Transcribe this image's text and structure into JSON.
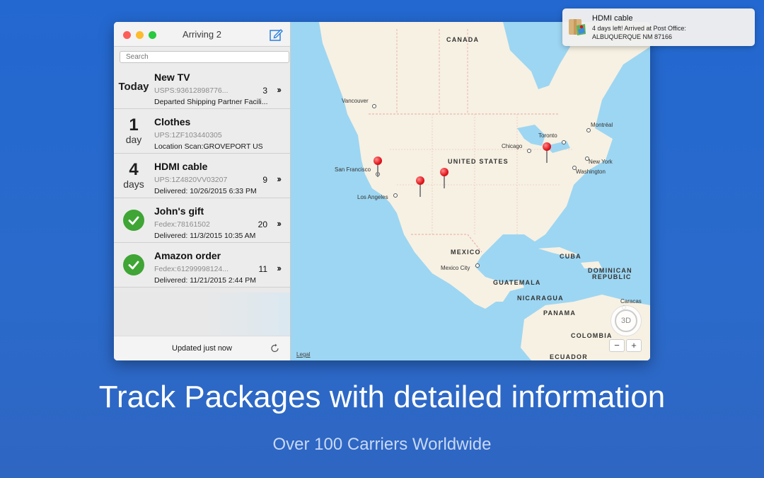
{
  "window": {
    "title": "Arriving 2",
    "search_placeholder": "Search",
    "footer_status": "Updated just now"
  },
  "packages": [
    {
      "name": "New TV",
      "eta_big": "",
      "eta_unit": "",
      "eta_label": "Today",
      "delivered": false,
      "tracking": "USPS:93612898776...",
      "status": "Departed Shipping Partner Facili...",
      "count": "3"
    },
    {
      "name": "Clothes",
      "eta_big": "1",
      "eta_unit": "day",
      "eta_label": "",
      "delivered": false,
      "tracking": "UPS:1ZF103440305",
      "status": "Location Scan:GROVEPORT US",
      "count": ""
    },
    {
      "name": "HDMI cable",
      "eta_big": "4",
      "eta_unit": "days",
      "eta_label": "",
      "delivered": false,
      "tracking": "UPS:1Z4820VV03207",
      "status": "Delivered: 10/26/2015 6:33 PM",
      "count": "9"
    },
    {
      "name": "John's gift",
      "eta_big": "",
      "eta_unit": "",
      "eta_label": "",
      "delivered": true,
      "tracking": "Fedex:78161502",
      "status": "Delivered: 11/3/2015 10:35 AM",
      "count": "20"
    },
    {
      "name": "Amazon order",
      "eta_big": "",
      "eta_unit": "",
      "eta_label": "",
      "delivered": true,
      "tracking": "Fedex:61299998124...",
      "status": "Delivered: 11/21/2015 2:44 PM",
      "count": "11"
    }
  ],
  "map": {
    "countries": [
      "CANADA",
      "UNITED STATES",
      "MEXICO",
      "CUBA",
      "DOMINICAN",
      "REPUBLIC",
      "GUATEMALA",
      "NICARAGUA",
      "PANAMA",
      "COLOMBIA",
      "ECUADOR"
    ],
    "cities": [
      "Vancouver",
      "San Francisco",
      "Los Angeles",
      "Chicago",
      "Toronto",
      "Montréal",
      "New York",
      "Washington",
      "Mexico City",
      "Caracas"
    ],
    "legal": "Legal",
    "compass_label": "3D",
    "zoom_out": "−",
    "zoom_in": "+"
  },
  "notification": {
    "title": "HDMI cable",
    "line1": "4 days left! Arrived at Post Office:",
    "line2": "ALBUQUERQUE NM 87166"
  },
  "marketing": {
    "headline": "Track Packages with detailed information",
    "subhead": "Over 100 Carriers Worldwide"
  },
  "colors": {
    "background": "#2368d0",
    "delivered_check": "#3fa535",
    "pin": "#e0141b",
    "water": "#9dd6f2",
    "land": "#f7f1e3"
  }
}
